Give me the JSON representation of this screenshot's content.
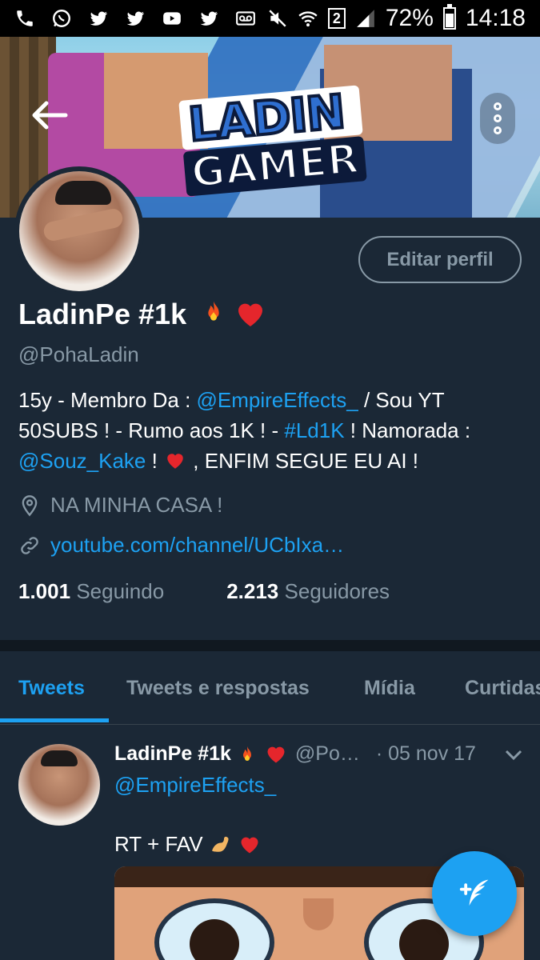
{
  "status_bar": {
    "battery": "72%",
    "time": "14:18",
    "sim": "2",
    "battery_level": 0.72
  },
  "banner": {
    "logo_line1": "LADIN",
    "logo_line2": "GAMER"
  },
  "profile": {
    "edit_label": "Editar perfil",
    "name": "LadinPe #1k",
    "handle": "@PohaLadin",
    "bio": {
      "p1": "15y - Membro Da : ",
      "m1": "@EmpireEffects_",
      "p2": " / Sou YT 50SUBS ! - Rumo aos 1K ! - ",
      "m2": "#Ld1K",
      "p3": " ! Namorada : ",
      "m3": "@Souz_Kake",
      "p4": " ! ",
      "p5": " , ENFIM SEGUE EU AI !"
    },
    "location": "NA MINHA CASA !",
    "url": "youtube.com/channel/UCbIxa…",
    "following_count": "1.001",
    "following_label": "Seguindo",
    "followers_count": "2.213",
    "followers_label": "Seguidores"
  },
  "tabs": [
    "Tweets",
    "Tweets e respostas",
    "Mídia",
    "Curtidas"
  ],
  "active_tab": "Tweets",
  "tweet": {
    "name": "LadinPe #1k",
    "handle": "@Po…",
    "date": "· 05 nov 17",
    "mention": "@EmpireEffects_",
    "text": "RT + FAV"
  },
  "colors": {
    "background": "#1b2836",
    "accent": "#1da1f2",
    "muted": "#8899a6"
  },
  "icons": [
    "phone-icon",
    "whatsapp-icon",
    "twitter-icon",
    "youtube-icon",
    "voicemail-icon",
    "mute-icon",
    "wifi-icon",
    "signal-icon",
    "back-arrow-icon",
    "more-options-icon",
    "location-icon",
    "link-icon",
    "fire-emoji-icon",
    "heart-emoji-icon",
    "flexed-biceps-emoji-icon",
    "caret-down-icon",
    "compose-tweet-icon"
  ]
}
